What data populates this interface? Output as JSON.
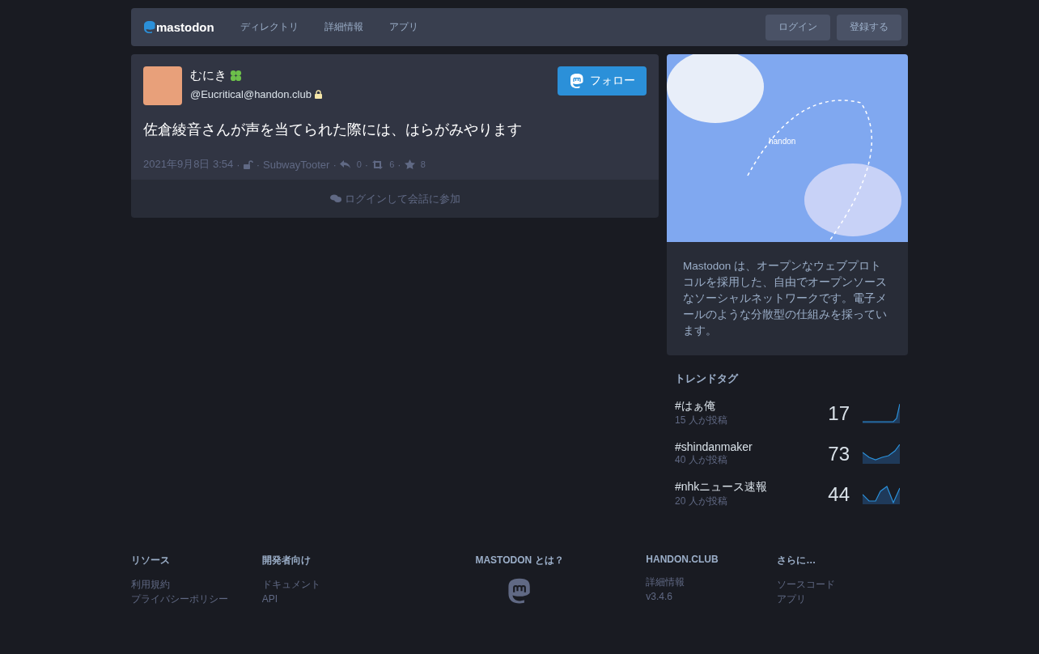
{
  "header": {
    "logo": "mastodon",
    "nav": [
      "ディレクトリ",
      "詳細情報",
      "アプリ"
    ],
    "buttons": [
      "ログイン",
      "登録する"
    ]
  },
  "status": {
    "display_name": "むにき",
    "account": "@Eucritical@handon.club",
    "content": "佐倉綾音さんが声を当てられた際には、はらがみやります",
    "follow": "フォロー",
    "date": "2021年9月8日 3:54",
    "separator": "·",
    "app": "SubwayTooter",
    "replies": "0",
    "boosts": "6",
    "favourites": "8",
    "join": "ログインして会話に参加"
  },
  "about": {
    "text": "Mastodon は、オープンなウェブプロトコルを採用した、自由でオープンソースなソーシャルネットワークです。電子メールのような分散型の仕組みを採っています。",
    "hero_label": "handon"
  },
  "trends": {
    "title": "トレンドタグ",
    "tags": [
      {
        "name": "#はぁ俺",
        "people": "15 人が投稿",
        "count": "17"
      },
      {
        "name": "#shindanmaker",
        "people": "40 人が投稿",
        "count": "73"
      },
      {
        "name": "#nhkニュース速報",
        "people": "20 人が投稿",
        "count": "44"
      }
    ]
  },
  "footer": [
    {
      "title": "リソース",
      "links": [
        "利用規約",
        "プライバシーポリシー"
      ]
    },
    {
      "title": "開発者向け",
      "links": [
        "ドキュメント",
        "API"
      ]
    },
    {
      "title": "MASTODON とは？",
      "kind": "logo"
    },
    {
      "title": "HANDON.CLUB",
      "links": [
        "詳細情報",
        "v3.4.6"
      ]
    },
    {
      "title": "さらに…",
      "links": [
        "ソースコード",
        "アプリ"
      ]
    }
  ]
}
